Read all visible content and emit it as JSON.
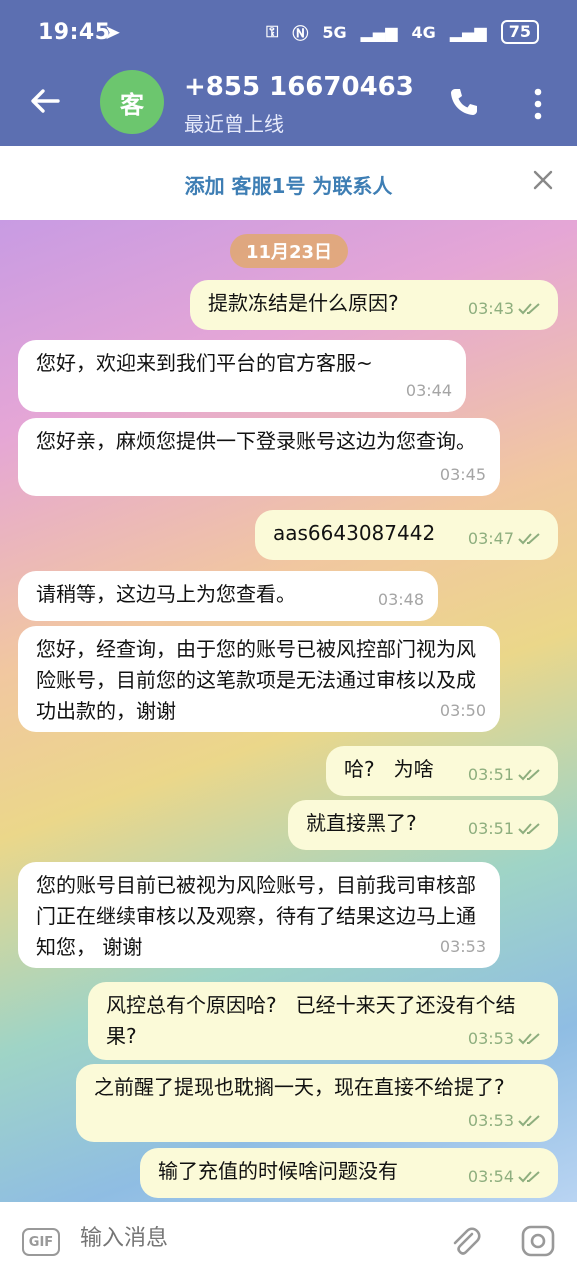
{
  "status_bar": {
    "time": "19:45",
    "network_labels": [
      "5G",
      "4G"
    ],
    "battery": "75"
  },
  "header": {
    "avatar_letter": "客",
    "avatar_color": "#6cc66e",
    "title": "+855 16670463",
    "subtitle": "最近曾上线"
  },
  "add_contact_bar": {
    "text": "添加 客服1号 为联系人"
  },
  "chat": {
    "date": "11月23日",
    "messages": [
      {
        "dir": "out",
        "text": "提款冻结是什么原因?",
        "time": "03:43"
      },
      {
        "dir": "in",
        "text": "您好，欢迎来到我们平台的官方客服~",
        "time": "03:44"
      },
      {
        "dir": "in",
        "text": "您好亲，麻烦您提供一下登录账号这边为您查询。",
        "time": "03:45"
      },
      {
        "dir": "out",
        "text": "aas6643087442",
        "time": "03:47"
      },
      {
        "dir": "in",
        "text": "请稍等，这边马上为您查看。",
        "time": "03:48"
      },
      {
        "dir": "in",
        "text": "您好，经查询，由于您的账号已被风控部门视为风险账号，目前您的这笔款项是无法通过审核以及成功出款的，谢谢",
        "time": "03:50"
      },
      {
        "dir": "out",
        "text": "哈?   为啥",
        "time": "03:51"
      },
      {
        "dir": "out",
        "text": "就直接黑了?",
        "time": "03:51"
      },
      {
        "dir": "in",
        "text": "您的账号目前已被视为风险账号，目前我司审核部门正在继续审核以及观察，待有了结果这边马上通知您，  谢谢",
        "time": "03:53"
      },
      {
        "dir": "out",
        "text": "风控总有个原因哈?   已经十来天了还没有个结果?",
        "time": "03:53"
      },
      {
        "dir": "out",
        "text": "之前醒了提现也耽搁一天，现在直接不给提了?",
        "time": "03:53"
      },
      {
        "dir": "out",
        "text": "输了充值的时候啥问题没有",
        "time": "03:54"
      }
    ]
  },
  "input_bar": {
    "gif_label": "GIF",
    "placeholder": "输入消息"
  }
}
